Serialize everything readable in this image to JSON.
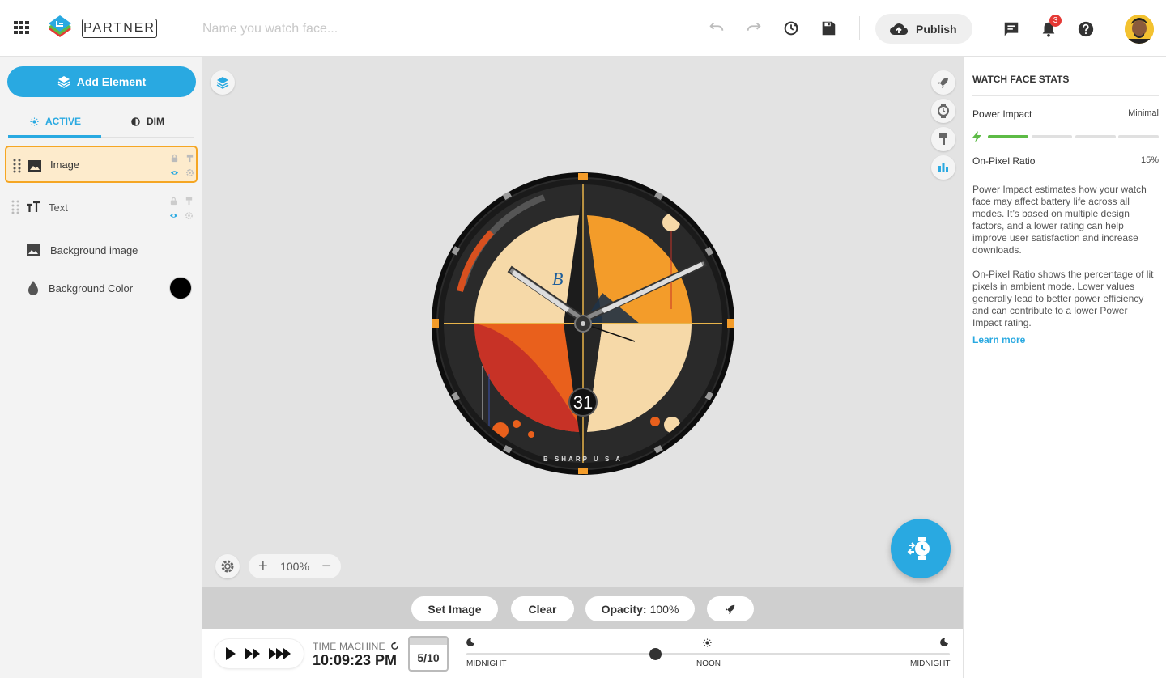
{
  "topbar": {
    "brand": "PARTNER",
    "name_placeholder": "Name you watch face...",
    "name_value": "",
    "publish_label": "Publish",
    "notification_count": "3"
  },
  "sidebar": {
    "add_element_label": "Add Element",
    "tabs": {
      "active": "ACTIVE",
      "dim": "DIM"
    },
    "layers": [
      {
        "label": "Image",
        "selected": true,
        "icon": "image-icon"
      },
      {
        "label": "Text",
        "selected": false,
        "icon": "text-icon"
      }
    ],
    "background_image_label": "Background image",
    "background_color_label": "Background Color",
    "background_color": "#000000"
  },
  "canvas": {
    "zoom": "100%",
    "watch": {
      "brand_text": "B SHARP  U S A",
      "date": "31"
    }
  },
  "image_toolbar": {
    "set_image": "Set Image",
    "clear": "Clear",
    "opacity_label": "Opacity:",
    "opacity_value": "100%"
  },
  "timeline": {
    "label": "TIME MACHINE",
    "time": "10:09:23 PM",
    "date": "5/10",
    "progress": 0.39,
    "marks": {
      "start": "MIDNIGHT",
      "mid": "NOON",
      "end": "MIDNIGHT"
    }
  },
  "stats": {
    "title": "WATCH FACE STATS",
    "power_label": "Power Impact",
    "power_value": "Minimal",
    "power_level": 1,
    "power_levels_total": 4,
    "ratio_label": "On-Pixel Ratio",
    "ratio_value": "15%",
    "para1": "Power Impact estimates how your watch face may affect battery life across all modes. It’s based on multiple design factors, and a lower rating can help improve user satisfaction and increase downloads.",
    "para2": "On-Pixel Ratio shows the percentage of lit pixels in ambient mode. Lower values generally lead to better power efficiency and can contribute to a lower Power Impact rating.",
    "learn_more": "Learn more"
  },
  "colors": {
    "accent": "#29a9e1",
    "selected_bg": "#fdebcc",
    "selected_border": "#f5a623",
    "power_good": "#5dbb46",
    "notif": "#e53935"
  }
}
